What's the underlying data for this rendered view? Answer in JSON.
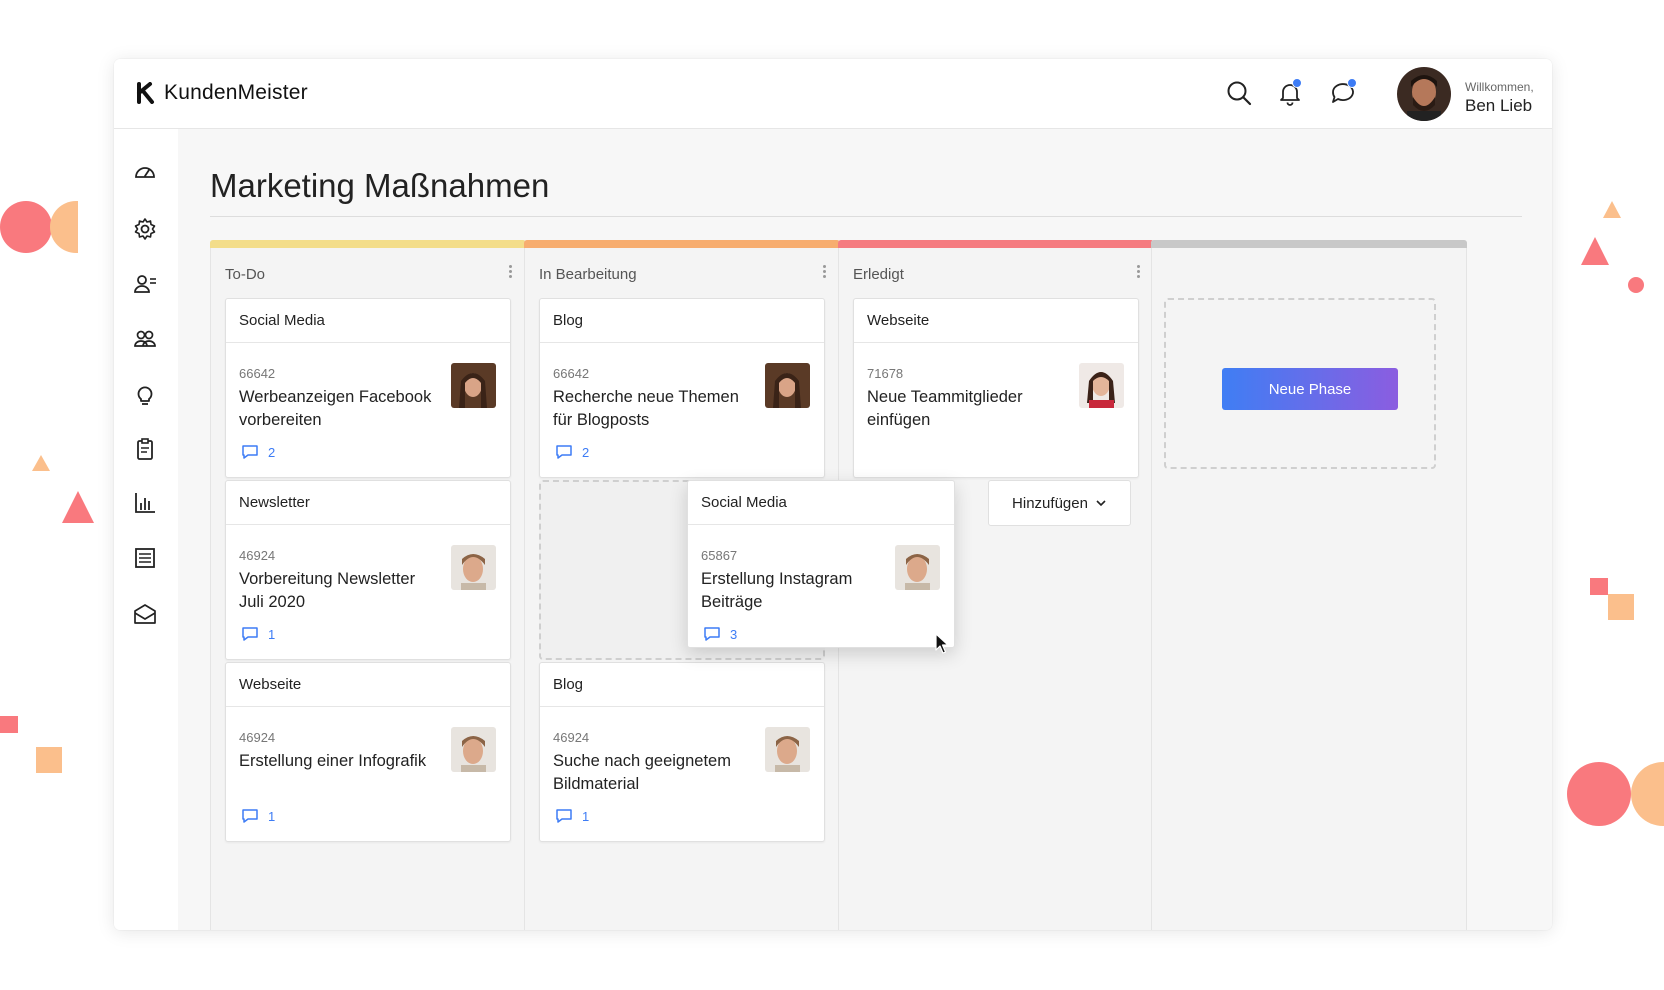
{
  "app": {
    "logo_text": "KundenMeister",
    "welcome_label": "Willkommen,",
    "user_name": "Ben Lieb"
  },
  "page": {
    "title": "Marketing Maßnahmen"
  },
  "colors": {
    "todo_bar": "#f3dd8a",
    "in_progress_bar": "#f7ad6f",
    "done_bar": "#f57b80",
    "new_phase_bar": "#c8c8c8",
    "accent_blue": "#3d7cf5",
    "gradient_end": "#8b5de0"
  },
  "columns": [
    {
      "title": "To-Do",
      "cards": [
        {
          "category": "Social Media",
          "number": "66642",
          "title": "Werbeanzeigen Facebook vorbereiten",
          "comments": "2"
        },
        {
          "category": "Newsletter",
          "number": "46924",
          "title": "Vorbereitung Newsletter Juli 2020",
          "comments": "1"
        },
        {
          "category": "Webseite",
          "number": "46924",
          "title": "Erstellung einer Infografik",
          "comments": "1"
        }
      ]
    },
    {
      "title": "In Bearbeitung",
      "cards": [
        {
          "category": "Blog",
          "number": "66642",
          "title": "Recherche neue Themen für Blogposts",
          "comments": "2"
        },
        {
          "category": "Blog",
          "number": "46924",
          "title": "Suche nach geeignetem Bildmaterial",
          "comments": "1"
        }
      ]
    },
    {
      "title": "Erledigt",
      "cards": [
        {
          "category": "Webseite",
          "number": "71678",
          "title": "Neue Teammitglieder einfügen",
          "comments": ""
        }
      ],
      "add_button": "Hinzufügen"
    }
  ],
  "dragging_card": {
    "category": "Social Media",
    "number": "65867",
    "title": "Erstellung Instagram Beiträge",
    "comments": "3"
  },
  "new_phase_button": "Neue Phase",
  "icons": {
    "top": [
      "search-icon",
      "bell-icon",
      "chat-icon"
    ],
    "sidebar": [
      "dashboard-icon",
      "settings-icon",
      "contacts-icon",
      "team-icon",
      "idea-icon",
      "clipboard-icon",
      "chart-icon",
      "list-icon",
      "mail-icon"
    ]
  }
}
